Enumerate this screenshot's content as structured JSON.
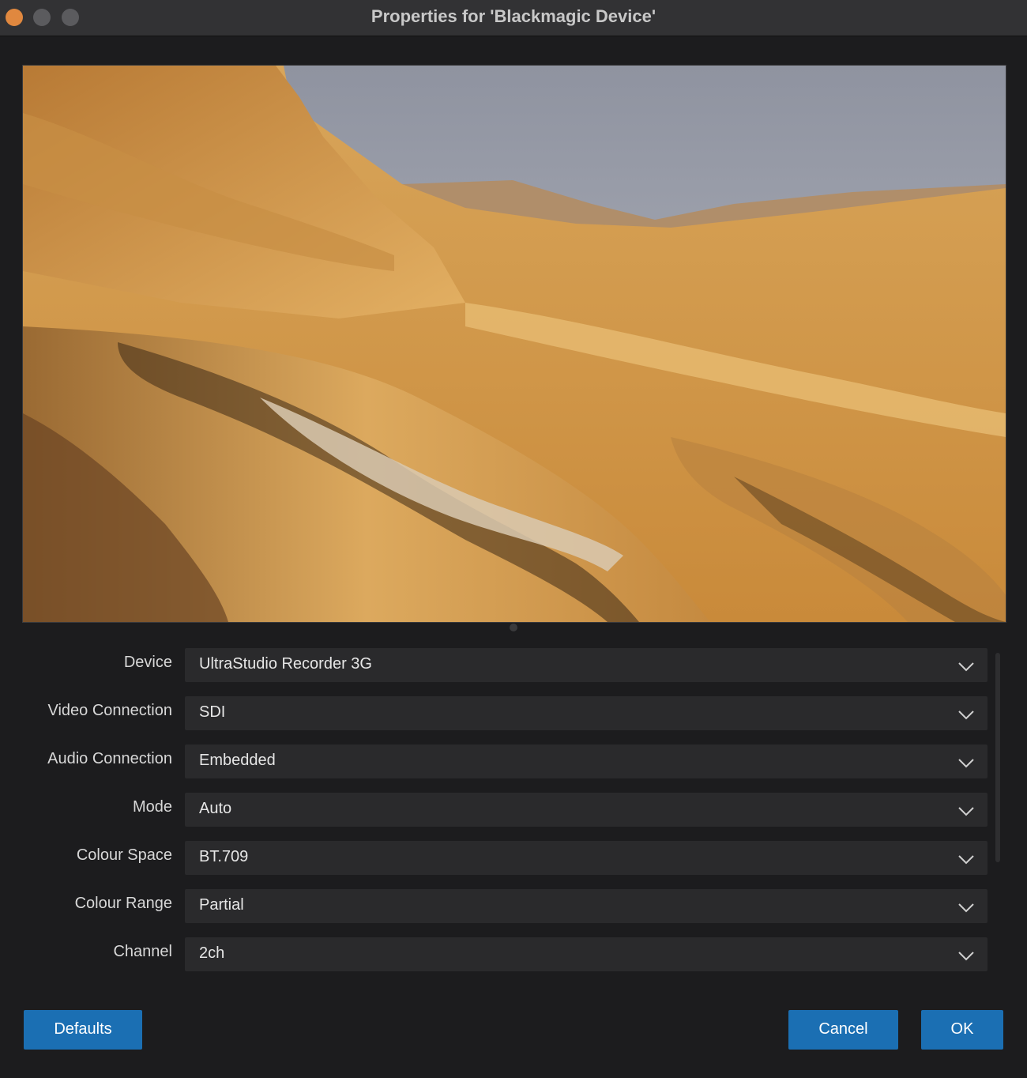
{
  "window": {
    "title": "Properties for 'Blackmagic Device'"
  },
  "preview": {
    "description_icon": "video-preview-image"
  },
  "properties": [
    {
      "label": "Device",
      "value": "UltraStudio Recorder 3G"
    },
    {
      "label": "Video Connection",
      "value": "SDI"
    },
    {
      "label": "Audio Connection",
      "value": "Embedded"
    },
    {
      "label": "Mode",
      "value": "Auto"
    },
    {
      "label": "Colour Space",
      "value": "BT.709"
    },
    {
      "label": "Colour Range",
      "value": "Partial"
    },
    {
      "label": "Channel",
      "value": "2ch"
    }
  ],
  "buttons": {
    "defaults": "Defaults",
    "cancel": "Cancel",
    "ok": "OK"
  },
  "colors": {
    "accent": "#1b6fb3",
    "background": "#1c1c1e",
    "field": "#2a2a2c",
    "close": "#e0883f"
  },
  "icons": {
    "dropdown": "chevron-down-icon"
  }
}
